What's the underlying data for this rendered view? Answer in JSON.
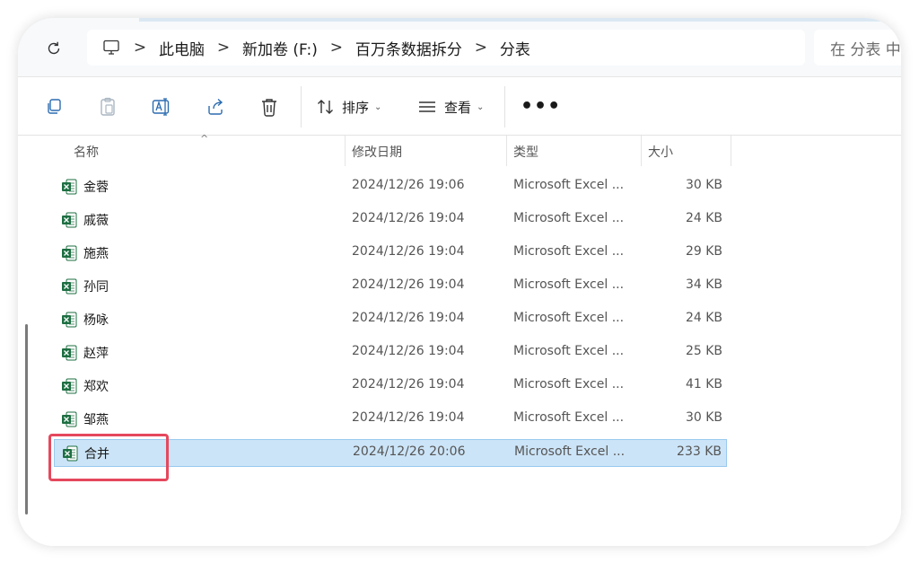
{
  "breadcrumb": {
    "items": [
      "此电脑",
      "新加卷 (F:)",
      "百万条数据拆分",
      "分表"
    ],
    "separator": ">"
  },
  "search": {
    "placeholder": "在 分表 中"
  },
  "toolbar": {
    "sort_label": "排序",
    "view_label": "查看",
    "more_label": "•••"
  },
  "columns": {
    "name": "名称",
    "date": "修改日期",
    "type": "类型",
    "size": "大小"
  },
  "files": [
    {
      "name": "金蓉",
      "date": "2024/12/26 19:06",
      "type": "Microsoft Excel ...",
      "size": "30 KB"
    },
    {
      "name": "戚薇",
      "date": "2024/12/26 19:04",
      "type": "Microsoft Excel ...",
      "size": "24 KB"
    },
    {
      "name": "施燕",
      "date": "2024/12/26 19:04",
      "type": "Microsoft Excel ...",
      "size": "29 KB"
    },
    {
      "name": "孙同",
      "date": "2024/12/26 19:04",
      "type": "Microsoft Excel ...",
      "size": "34 KB"
    },
    {
      "name": "杨咏",
      "date": "2024/12/26 19:04",
      "type": "Microsoft Excel ...",
      "size": "24 KB"
    },
    {
      "name": "赵萍",
      "date": "2024/12/26 19:04",
      "type": "Microsoft Excel ...",
      "size": "25 KB"
    },
    {
      "name": "郑欢",
      "date": "2024/12/26 19:04",
      "type": "Microsoft Excel ...",
      "size": "41 KB"
    },
    {
      "name": "邹燕",
      "date": "2024/12/26 19:04",
      "type": "Microsoft Excel ...",
      "size": "30 KB"
    },
    {
      "name": "合并",
      "date": "2024/12/26 20:06",
      "type": "Microsoft Excel ...",
      "size": "233 KB",
      "selected": true
    }
  ],
  "colors": {
    "selection": "#cce4f7",
    "highlight": "#e5485d",
    "excel_green": "#1d6f42"
  }
}
